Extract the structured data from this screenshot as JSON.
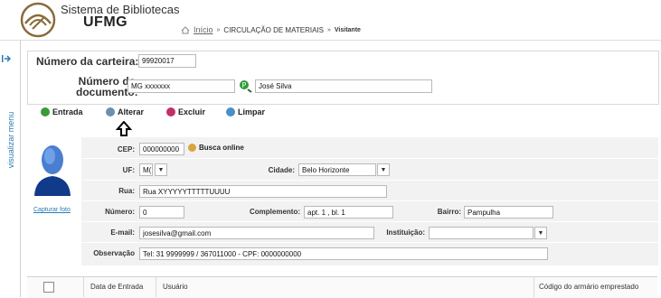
{
  "header": {
    "title": "Sistema de Bibliotecas",
    "subtitle": "UFMG",
    "breadcrumb": {
      "home": "Início",
      "section": "CIRCULAÇÃO DE MATERIAIS",
      "current": "Visitante"
    }
  },
  "sidebar": {
    "toggle_label": "visualizar menu"
  },
  "card": {
    "number_label": "Número da carteira:",
    "number_value": "99920017",
    "doc_label_line1": "Número do",
    "doc_label_line2": "documento:",
    "doc_value": "MG xxxxxxx",
    "name_value": "José Silva"
  },
  "toolbar": {
    "entrada": "Entrada",
    "alterar": "Alterar",
    "excluir": "Excluir",
    "limpar": "Limpar"
  },
  "photo": {
    "capture_link": "Capturar foto"
  },
  "form": {
    "cep_label": "CEP:",
    "cep_value": "000000000",
    "busca_label": "Busca online",
    "uf_label": "UF:",
    "uf_value": "M(",
    "cidade_label": "Cidade:",
    "cidade_value": "Belo Horizonte",
    "rua_label": "Rua:",
    "rua_value": "Rua XYYYYYTTTTTUUUU",
    "numero_label": "Número:",
    "numero_value": "0",
    "complemento_label": "Complemento:",
    "complemento_value": "apt. 1 , bl. 1",
    "bairro_label": "Bairro:",
    "bairro_value": "Pampulha",
    "email_label": "E-mail:",
    "email_value": "josesilva@gmail.com",
    "instituicao_label": "Instituição:",
    "instituicao_value": "",
    "observacao_label": "Observação",
    "observacao_value": "Tel: 31 9999999 / 367011000 - CPF: 0000000000"
  },
  "table": {
    "columns": [
      "Data de Entrada",
      "Usuário",
      "Código do armário emprestado"
    ]
  },
  "colors": {
    "accent": "#2c7bb6",
    "green": "#3a9a3a",
    "red": "#c0306a"
  }
}
